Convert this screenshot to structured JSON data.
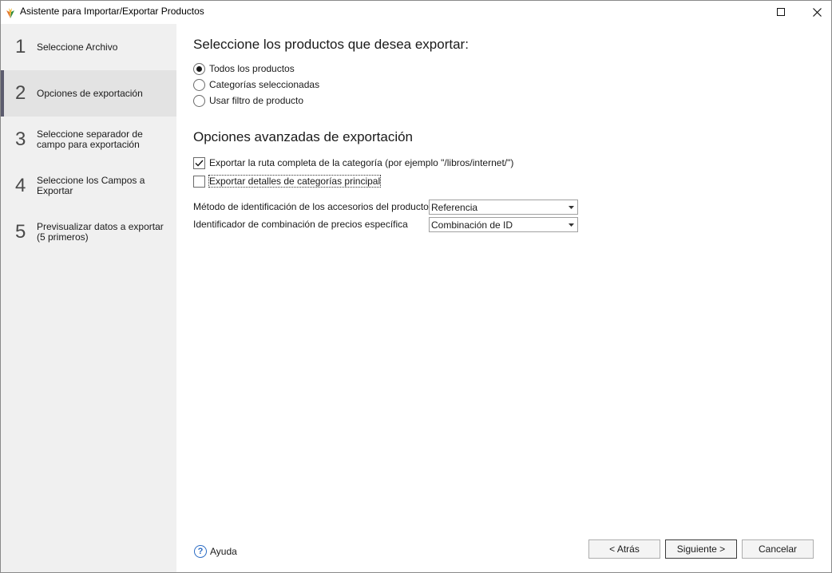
{
  "window": {
    "title": "Asistente para Importar/Exportar Productos"
  },
  "steps": [
    {
      "num": "1",
      "label": "Seleccione Archivo",
      "active": false
    },
    {
      "num": "2",
      "label": "Opciones de exportación",
      "active": true
    },
    {
      "num": "3",
      "label": "Seleccione separador de campo para exportación",
      "active": false
    },
    {
      "num": "4",
      "label": "Seleccione los Campos a Exportar",
      "active": false
    },
    {
      "num": "5",
      "label": "Previsualizar datos a exportar (5 primeros)",
      "active": false
    }
  ],
  "main": {
    "heading_products": "Seleccione los productos que desea exportar:",
    "product_options": [
      {
        "label": "Todos los productos",
        "selected": true
      },
      {
        "label": "Categorías seleccionadas",
        "selected": false
      },
      {
        "label": "Usar filtro de producto",
        "selected": false
      }
    ],
    "heading_advanced": "Opciones avanzadas de exportación",
    "advanced_options": [
      {
        "label": "Exportar la ruta completa de la categoría (por ejemplo \"/libros/internet/\")",
        "checked": true
      },
      {
        "label": "Exportar detalles de categorías principal",
        "checked": false
      }
    ],
    "fields": [
      {
        "label": "Método de identificación de los accesorios del producto",
        "value": "Referencia"
      },
      {
        "label": "Identificador de combinación de precios específica",
        "value": "Combinación de ID"
      }
    ]
  },
  "footer": {
    "help_label": "Ayuda",
    "back_label": "< Atrás",
    "next_label": "Siguiente >",
    "cancel_label": "Cancelar"
  },
  "colors": {
    "sidebar_bg": "#f0f0f0",
    "active_step_bg": "#e3e3e3",
    "active_step_marker": "#5c5c6e",
    "help_icon": "#2a6bc4"
  }
}
